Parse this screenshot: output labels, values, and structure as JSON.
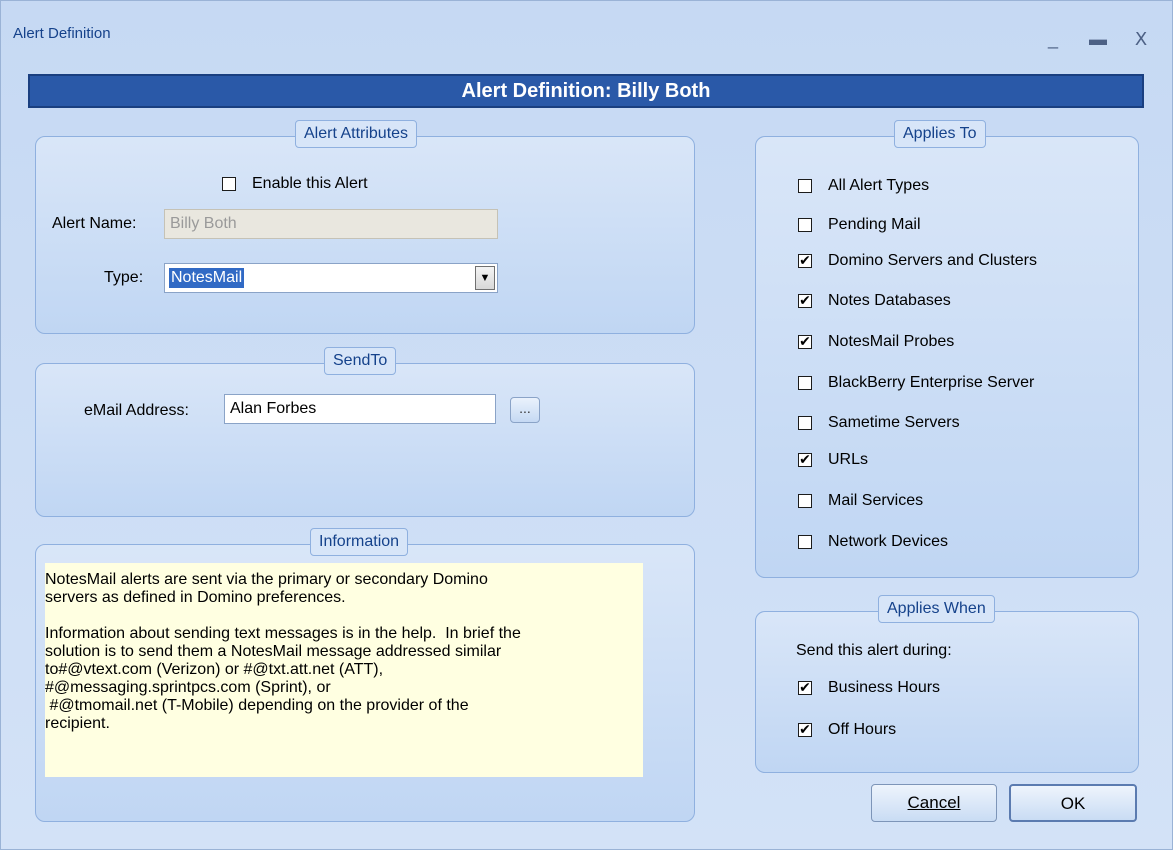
{
  "window": {
    "title": "Alert Definition",
    "minimize": "_",
    "maximize": "▬",
    "close": "X"
  },
  "banner": {
    "text": "Alert Definition: Billy Both"
  },
  "alert_attributes": {
    "legend": "Alert Attributes",
    "enable_label": "Enable this Alert",
    "enable_checked": false,
    "name_label": "Alert Name:",
    "name_value": "Billy Both",
    "type_label": "Type:",
    "type_value": "NotesMail",
    "dropdown_arrow": "▼"
  },
  "send_to": {
    "legend": "SendTo",
    "email_label": "eMail Address:",
    "email_value": "Alan Forbes",
    "browse_label": "..."
  },
  "information": {
    "legend": "Information",
    "paragraph1": "NotesMail alerts are sent via the primary or secondary Domino\nservers as defined in Domino preferences.",
    "paragraph2": "Information about sending text messages is in the help.  In brief the\nsolution is to send them a NotesMail message addressed similar\nto#@vtext.com (Verizon) or #@txt.att.net (ATT),\n#@messaging.sprintpcs.com (Sprint), or\n #@tmomail.net (T-Mobile) depending on the provider of the\nrecipient."
  },
  "applies_to": {
    "legend": "Applies To",
    "items": [
      {
        "label": "All Alert Types",
        "checked": false,
        "mark": ""
      },
      {
        "label": "Pending Mail",
        "checked": false,
        "mark": ""
      },
      {
        "label": "Domino Servers and Clusters",
        "checked": true,
        "mark": "✔"
      },
      {
        "label": "Notes Databases",
        "checked": true,
        "mark": "✔"
      },
      {
        "label": "NotesMail Probes",
        "checked": true,
        "mark": "✔"
      },
      {
        "label": "BlackBerry Enterprise Server",
        "checked": false,
        "mark": ""
      },
      {
        "label": "Sametime Servers",
        "checked": false,
        "mark": ""
      },
      {
        "label": "URLs",
        "checked": true,
        "mark": "✔"
      },
      {
        "label": "Mail Services",
        "checked": false,
        "mark": ""
      },
      {
        "label": "Network Devices",
        "checked": false,
        "mark": ""
      }
    ]
  },
  "applies_when": {
    "legend": "Applies When",
    "caption": "Send this alert during:",
    "items": [
      {
        "label": "Business Hours",
        "checked": true,
        "mark": "✔"
      },
      {
        "label": "Off Hours",
        "checked": true,
        "mark": "✔"
      }
    ]
  },
  "buttons": {
    "cancel": "Cancel",
    "ok": "OK"
  }
}
